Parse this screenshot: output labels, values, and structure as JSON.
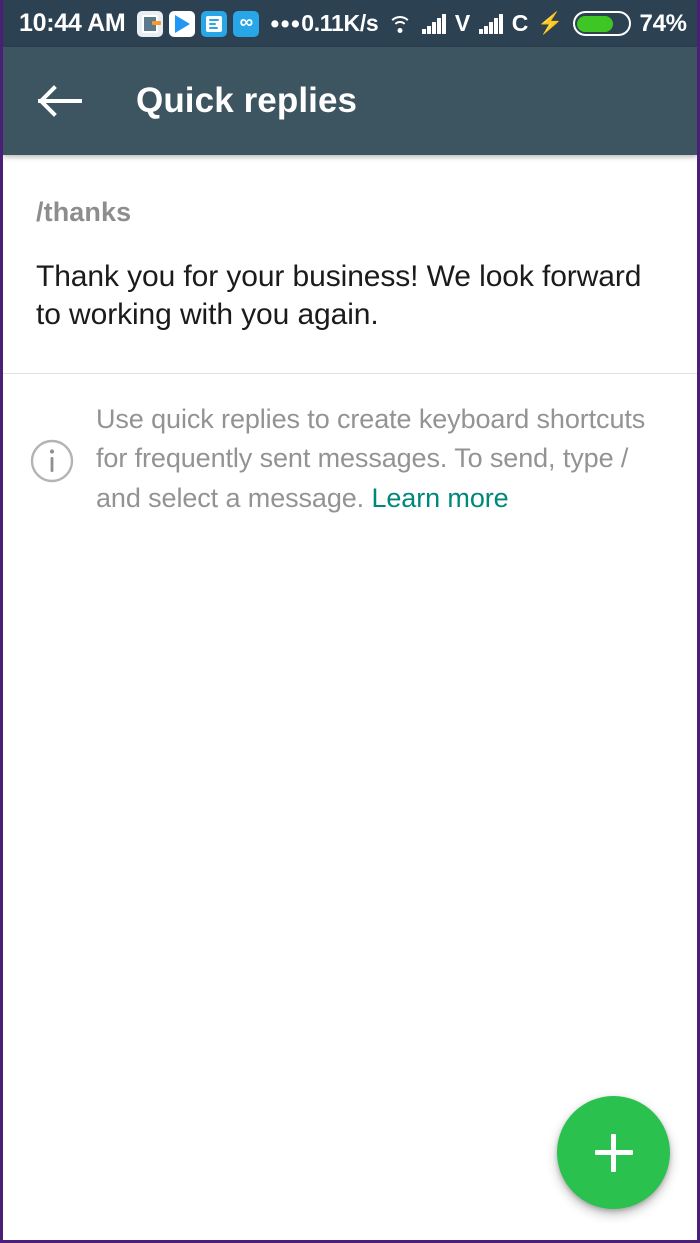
{
  "status_bar": {
    "clock": "10:44 AM",
    "notification_icons": [
      "screenshot-icon",
      "play-store-icon",
      "document-icon",
      "infinity-icon"
    ],
    "overflow_dots": "•••",
    "network_speed": "0.11K/s",
    "wifi": "wifi-icon",
    "sim1_label": "V",
    "sim2_label": "C",
    "charging": "⚡",
    "battery_percent": "74%",
    "battery_level": 74,
    "background_color": "#2c4152"
  },
  "app_bar": {
    "back_label": "back-arrow",
    "title": "Quick replies",
    "background_color": "#3d5561"
  },
  "quick_reply": {
    "shortcut": "/thanks",
    "message": "Thank you for your business! We look forward to working with you again."
  },
  "info": {
    "icon": "info-icon",
    "text": "Use quick replies to create keyboard shortcuts for frequently sent messages. To send, type / and select a message. ",
    "link_label": "Learn more",
    "link_color": "#00897b"
  },
  "fab": {
    "icon": "plus-icon",
    "label": "Add quick reply",
    "color": "#2bc14f"
  }
}
